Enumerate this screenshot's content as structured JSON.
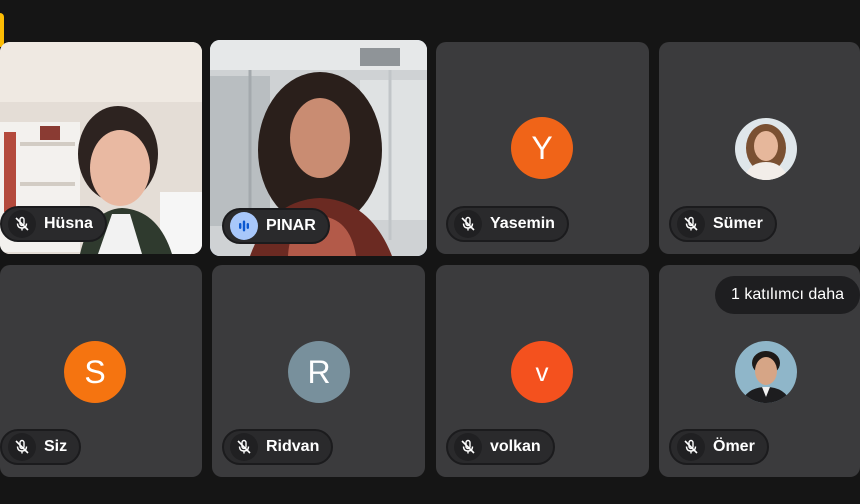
{
  "participants": [
    {
      "name": "Hüsna",
      "type": "video",
      "mic": "muted"
    },
    {
      "name": "PINAR",
      "type": "video",
      "mic": "speaking"
    },
    {
      "name": "Yasemin",
      "type": "letter",
      "initial": "Y",
      "color": "#f06418",
      "mic": "muted"
    },
    {
      "name": "Sümer",
      "type": "photo",
      "mic": "muted"
    },
    {
      "name": "Siz",
      "type": "letter",
      "initial": "S",
      "color": "#f57410",
      "mic": "muted"
    },
    {
      "name": "Ridvan",
      "type": "letter",
      "initial": "R",
      "color": "#78909c",
      "mic": "muted"
    },
    {
      "name": "volkan",
      "type": "letter",
      "initial": "V",
      "color": "#f4511e",
      "mic": "muted"
    },
    {
      "name": "Ömer",
      "type": "photo",
      "mic": "muted"
    }
  ],
  "more_participants": "1 katılımcı daha",
  "icons": {
    "muted": "mic-off-icon",
    "speaking": "audio-level-icon"
  },
  "colors": {
    "active_outline": "#a8c7fa",
    "tile_bg": "#3b3b3d",
    "page_bg": "#151515"
  }
}
